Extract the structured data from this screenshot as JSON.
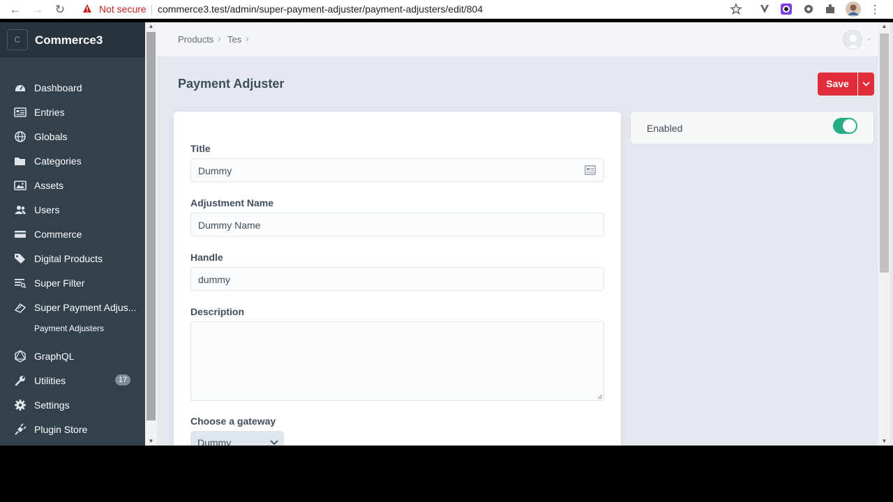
{
  "browser": {
    "not_secure": "Not secure",
    "url": "commerce3.test/admin/super-payment-adjuster/payment-adjusters/edit/804"
  },
  "sidebar": {
    "brand_letter": "C",
    "brand_name": "Commerce3",
    "items": [
      {
        "label": "Dashboard",
        "icon": "dashboard-icon"
      },
      {
        "label": "Entries",
        "icon": "entries-icon"
      },
      {
        "label": "Globals",
        "icon": "globe-icon"
      },
      {
        "label": "Categories",
        "icon": "folder-icon"
      },
      {
        "label": "Assets",
        "icon": "image-icon"
      },
      {
        "label": "Users",
        "icon": "users-icon"
      },
      {
        "label": "Commerce",
        "icon": "commerce-icon"
      },
      {
        "label": "Digital Products",
        "icon": "tags-icon"
      },
      {
        "label": "Super Filter",
        "icon": "filter-icon"
      },
      {
        "label": "Super Payment Adjus...",
        "icon": "payment-icon"
      },
      {
        "label": "GraphQL",
        "icon": "graphql-icon"
      },
      {
        "label": "Utilities",
        "icon": "wrench-icon",
        "badge": "17"
      },
      {
        "label": "Settings",
        "icon": "gear-icon"
      },
      {
        "label": "Plugin Store",
        "icon": "plug-icon"
      }
    ],
    "subitem": "Payment Adjusters"
  },
  "header": {
    "breadcrumbs": [
      "Products",
      "Tes"
    ],
    "title": "Payment Adjuster",
    "save_label": "Save"
  },
  "form": {
    "title_label": "Title",
    "title_value": "Dummy",
    "adjustment_label": "Adjustment Name",
    "adjustment_value": "Dummy Name",
    "handle_label": "Handle",
    "handle_value": "dummy",
    "description_label": "Description",
    "description_value": "",
    "gateway_label": "Choose a gateway",
    "gateway_value": "Dummy"
  },
  "status": {
    "enabled_label": "Enabled",
    "enabled": true
  },
  "colors": {
    "accent": "#e12d39",
    "toggle_on": "#27ab83",
    "sidebar": "#33414d"
  }
}
